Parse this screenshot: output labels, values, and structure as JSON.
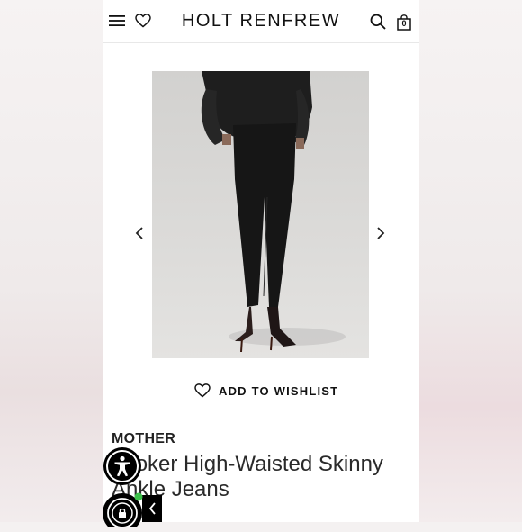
{
  "header": {
    "brand": "HOLT RENFREW",
    "bag_count": "0",
    "icons": [
      "menu-icon",
      "heart-icon",
      "search-icon",
      "shopping-bag-icon"
    ]
  },
  "product": {
    "brand_name": "MOTHER",
    "title": "Looker High-Waisted Skinny Ankle Jeans",
    "wishlist_label": "ADD TO WISHLIST"
  },
  "carousel": {
    "icons": [
      "chevron-left-icon",
      "chevron-right-icon"
    ]
  },
  "overlays": {
    "icons": [
      "accessibility-icon",
      "lock-icon",
      "collapse-chevron-icon"
    ],
    "status_color": "#3cc04a"
  }
}
